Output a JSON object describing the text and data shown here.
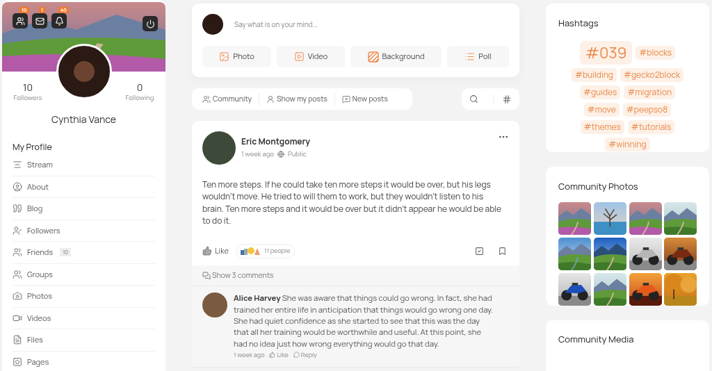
{
  "profile": {
    "badges": [
      {
        "count": "10"
      },
      {
        "count": "1"
      },
      {
        "count": "40"
      }
    ],
    "stats": [
      {
        "value": "10",
        "label": "Followers"
      },
      {
        "value": "0",
        "label": "Following"
      }
    ],
    "name": "Cynthia Vance"
  },
  "menu": {
    "title": "My Profile",
    "items": [
      {
        "label": "Stream"
      },
      {
        "label": "About"
      },
      {
        "label": "Blog"
      },
      {
        "label": "Followers"
      },
      {
        "label": "Friends",
        "count": "10"
      },
      {
        "label": "Groups"
      },
      {
        "label": "Photos"
      },
      {
        "label": "Videos"
      },
      {
        "label": "Files"
      },
      {
        "label": "Pages"
      }
    ]
  },
  "composer": {
    "placeholder": "Say what is on your mind...",
    "buttons": [
      {
        "label": "Photo"
      },
      {
        "label": "Video"
      },
      {
        "label": "Background"
      },
      {
        "label": "Poll"
      }
    ]
  },
  "filters": [
    {
      "label": "Community"
    },
    {
      "label": "Show my posts"
    },
    {
      "label": "New posts"
    }
  ],
  "post": {
    "author": "Eric Montgomery",
    "time": "1 week ago",
    "privacy": "Public",
    "text": "Ten more steps. If he could take ten more steps it would be over, but his legs wouldn't move. He tried to will them to work, but they wouldn't listen to his brain. Ten more steps and it would be over but it didn't appear he would be able to do it.",
    "like": "Like",
    "reactions": "11 people",
    "show_comments": "Show 3 comments",
    "comments": [
      {
        "text": "**Alice Harvey** She was aware that things could go wrong. In fact, she had trained her entire life in anticipation that things would go wrong one day. She had quiet confidence as she started to see that this was the day that all her training would be worthwhile and useful. At this point, she had no idea just how wrong everything would go that day.",
        "time": "1 week ago",
        "like": "Like",
        "reply": "Reply"
      }
    ]
  },
  "hashtags": {
    "title": "Hashtags",
    "tags": [
      {
        "label": "#039",
        "kind": "large"
      },
      {
        "label": "#blocks",
        "kind": "normal"
      },
      {
        "label": "#building",
        "kind": "normal"
      },
      {
        "label": "#gecko2block",
        "kind": "normal"
      },
      {
        "label": "#guides",
        "kind": "normal"
      },
      {
        "label": "#migration",
        "kind": "normal"
      },
      {
        "label": "#move",
        "kind": "normal"
      },
      {
        "label": "#peepso8",
        "kind": "normal"
      },
      {
        "label": "#themes",
        "kind": "normal"
      },
      {
        "label": "#tutorials",
        "kind": "normal"
      },
      {
        "label": "#winning",
        "kind": "normal"
      }
    ]
  },
  "community_photos": {
    "title": "Community Photos"
  },
  "community_media": {
    "title": "Community Media"
  }
}
